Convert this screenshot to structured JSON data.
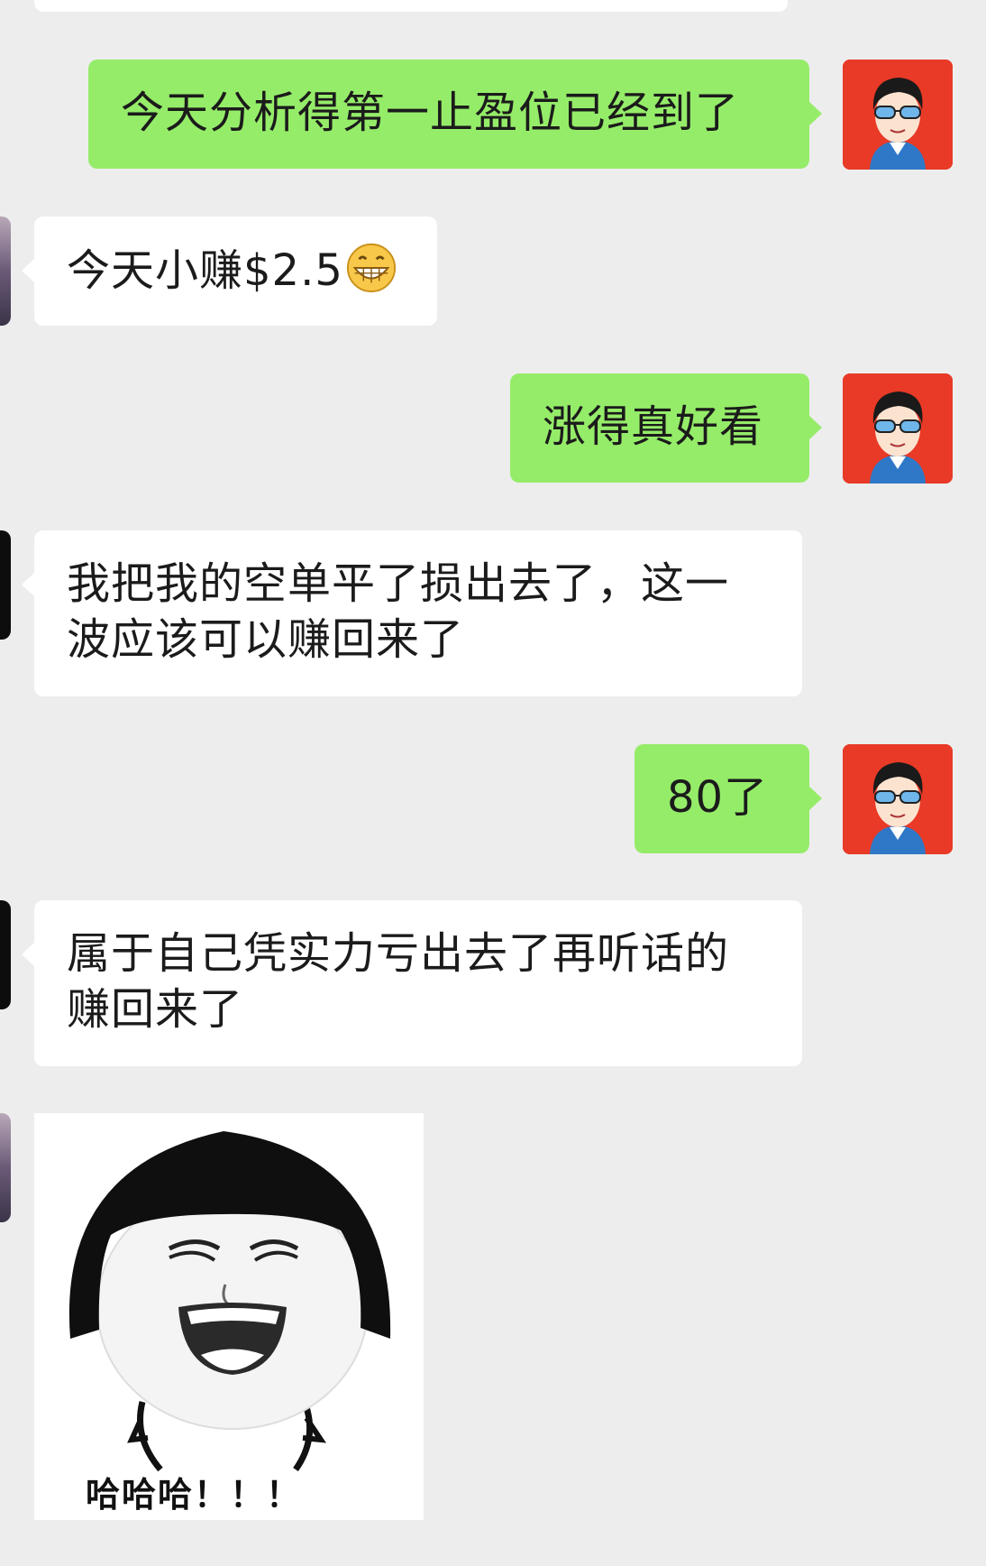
{
  "colors": {
    "background": "#ededed",
    "outgoing_bubble": "#95ec69",
    "incoming_bubble": "#ffffff",
    "self_avatar_bg": "#e83a26"
  },
  "messages": [
    {
      "id": "m1",
      "direction": "outgoing",
      "text": "今天分析得第一止盈位已经到了"
    },
    {
      "id": "m2",
      "direction": "incoming",
      "text": "今天小赚$2.5",
      "emoji": "grinning-face-icon"
    },
    {
      "id": "m3",
      "direction": "outgoing",
      "text": "涨得真好看"
    },
    {
      "id": "m4",
      "direction": "incoming",
      "text": "我把我的空单平了损出去了，这一\n波应该可以赚回来了"
    },
    {
      "id": "m5",
      "direction": "outgoing",
      "text": "80了"
    },
    {
      "id": "m6",
      "direction": "incoming",
      "text": "属于自己凭实力亏出去了再听话的\n赚回来了"
    },
    {
      "id": "m7",
      "direction": "incoming",
      "type": "sticker",
      "caption": "哈哈哈！！！"
    }
  ]
}
